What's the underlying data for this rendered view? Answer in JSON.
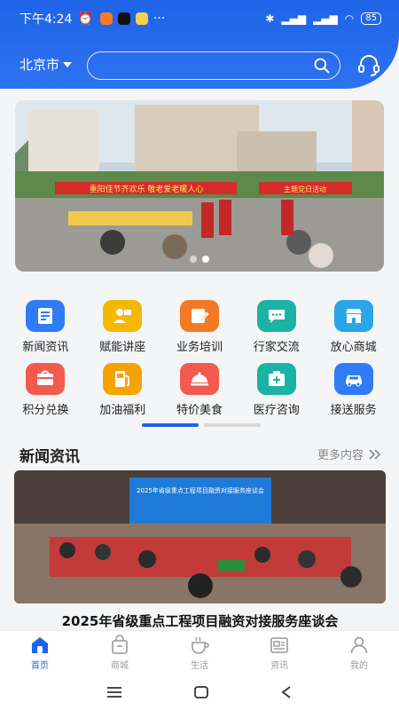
{
  "status_bar": {
    "time": "下午4:24",
    "battery": "85"
  },
  "header": {
    "city": "北京市",
    "search": {
      "placeholder": ""
    }
  },
  "banner": {
    "sign_left": "重阳佳节齐欢乐 敬老爱老暖人心",
    "sign_right": "主题党日活动"
  },
  "grid": [
    {
      "label": "新闻资讯",
      "color": "#2f7cf6",
      "icon": "news-icon"
    },
    {
      "label": "赋能讲座",
      "color": "#f5b800",
      "icon": "lecture-icon"
    },
    {
      "label": "业务培训",
      "color": "#f27a27",
      "icon": "training-icon"
    },
    {
      "label": "行家交流",
      "color": "#1bb3a3",
      "icon": "chat-icon"
    },
    {
      "label": "放心商城",
      "color": "#2aa5e8",
      "icon": "store-icon"
    },
    {
      "label": "积分兑换",
      "color": "#f25a4e",
      "icon": "points-icon"
    },
    {
      "label": "加油福利",
      "color": "#f5a300",
      "icon": "fuel-icon"
    },
    {
      "label": "特价美食",
      "color": "#f25a4e",
      "icon": "food-icon"
    },
    {
      "label": "医疗咨询",
      "color": "#1bb3a3",
      "icon": "medical-icon"
    },
    {
      "label": "接送服务",
      "color": "#2f7cf6",
      "icon": "car-icon"
    }
  ],
  "news": {
    "section_title": "新闻资讯",
    "more_label": "更多内容",
    "screen_text": "2025年省级重点工程项目融资对接服务座谈会",
    "headline": "2025年省级重点工程项目融资对接服务座谈会"
  },
  "tabbar": [
    {
      "label": "首页",
      "icon": "home-icon",
      "active": true
    },
    {
      "label": "商城",
      "icon": "shop-bag-icon",
      "active": false
    },
    {
      "label": "生活",
      "icon": "coffee-icon",
      "active": false
    },
    {
      "label": "资讯",
      "icon": "info-icon",
      "active": false
    },
    {
      "label": "我的",
      "icon": "user-icon",
      "active": false
    }
  ],
  "colors": {
    "primary": "#1f63e8",
    "tab_inactive": "#999999"
  }
}
